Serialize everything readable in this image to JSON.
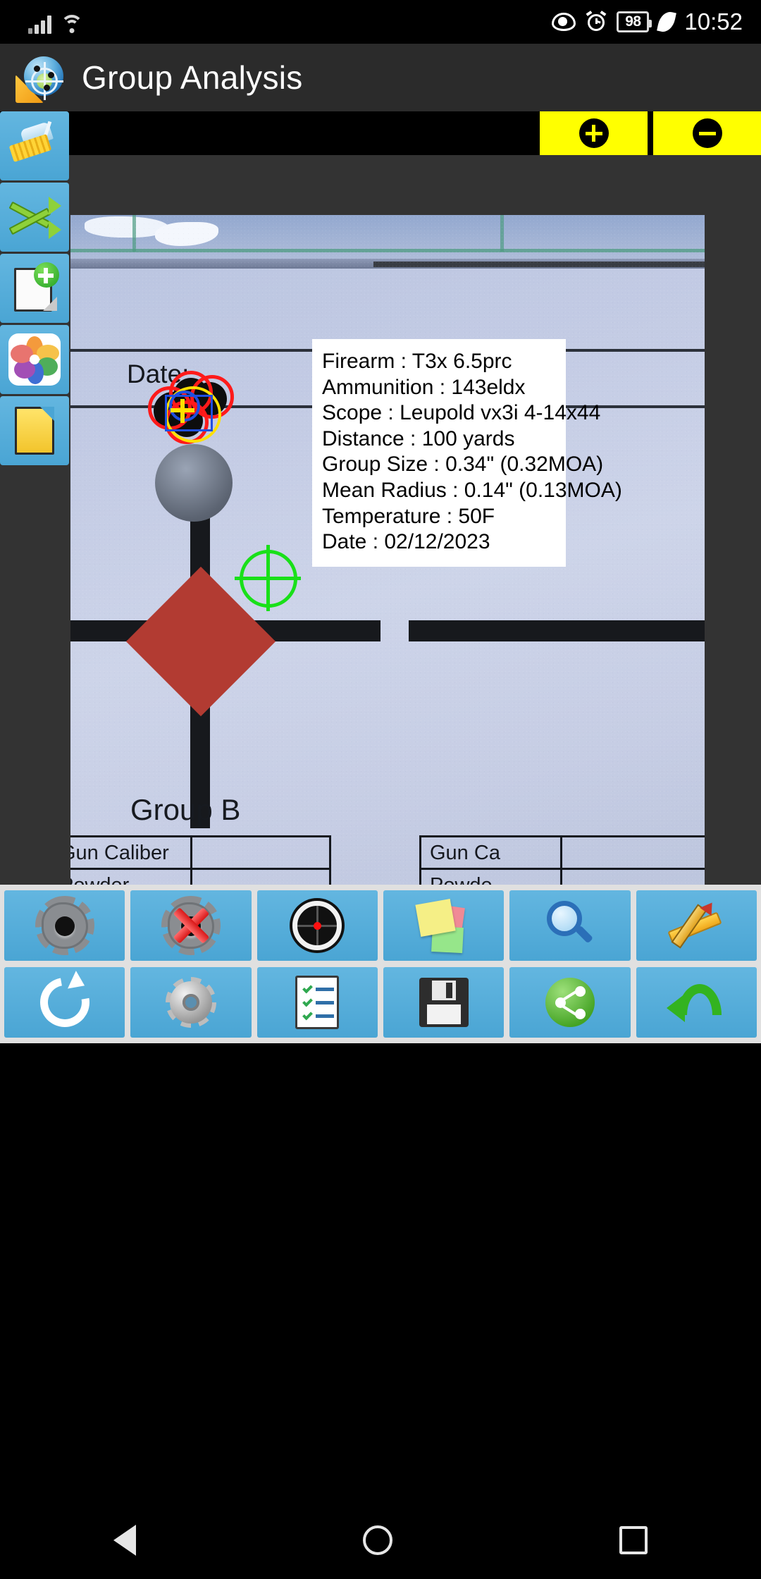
{
  "statusbar": {
    "time": "10:52",
    "battery": "98",
    "icons": [
      "signal-bars-icon",
      "wifi-icon",
      "eye-icon",
      "alarm-icon",
      "battery-icon",
      "leaf-icon"
    ]
  },
  "appbar": {
    "title": "Group Analysis",
    "logo": "group-analysis-logo-icon"
  },
  "zoom_controls": [
    {
      "name": "zoom-in-button",
      "label": "+"
    },
    {
      "name": "zoom-out-button",
      "label": "−"
    }
  ],
  "sidebar": {
    "items": [
      {
        "name": "clean-button",
        "icon": "broom-icon"
      },
      {
        "name": "shuffle-button",
        "icon": "shuffle-arrows-icon"
      },
      {
        "name": "new-group-button",
        "icon": "new-document-plus-icon"
      },
      {
        "name": "gallery-button",
        "icon": "photos-flower-icon"
      },
      {
        "name": "notes-button",
        "icon": "yellow-document-icon"
      }
    ]
  },
  "photo": {
    "date_label": "Date:",
    "group_label": "Group B",
    "tables": [
      {
        "rows": [
          "Gun Caliber",
          "Powder"
        ]
      },
      {
        "rows": [
          "Gun Ca",
          "Powde"
        ]
      }
    ]
  },
  "info_panel": {
    "lines": [
      "Firearm : T3x 6.5prc",
      "Ammunition : 143eldx",
      "Scope : Leupold vx3i 4-14x44",
      "Distance : 100 yards",
      "Group Size : 0.34\" (0.32MOA)",
      "Mean Radius : 0.14\" (0.13MOA)",
      "Temperature : 50F",
      "Date : 02/12/2023"
    ],
    "firearm": "T3x 6.5prc",
    "ammunition": "143eldx",
    "scope": "Leupold vx3i 4-14x44",
    "distance": "100 yards",
    "group_size": "0.34\" (0.32MOA)",
    "mean_radius": "0.14\" (0.13MOA)",
    "temperature": "50F",
    "date": "02/12/2023"
  },
  "toolbar": {
    "row1": [
      {
        "name": "add-shot-button",
        "icon": "bullet-hole-icon"
      },
      {
        "name": "delete-shot-button",
        "icon": "bullet-hole-delete-icon"
      },
      {
        "name": "set-target-button",
        "icon": "target-reticle-icon"
      },
      {
        "name": "notes-button",
        "icon": "sticky-notes-icon"
      },
      {
        "name": "zoom-button",
        "icon": "magnifier-icon"
      },
      {
        "name": "measure-button",
        "icon": "ruler-pencil-icon"
      }
    ],
    "row2": [
      {
        "name": "rotate-button",
        "icon": "refresh-rotate-icon"
      },
      {
        "name": "settings-button",
        "icon": "gear-icon"
      },
      {
        "name": "report-button",
        "icon": "checklist-icon"
      },
      {
        "name": "save-button",
        "icon": "floppy-disk-icon"
      },
      {
        "name": "share-button",
        "icon": "share-icon"
      },
      {
        "name": "back-button",
        "icon": "undo-arrow-icon"
      }
    ]
  },
  "navbar": {
    "items": [
      {
        "name": "nav-back-button",
        "icon": "triangle-back-icon"
      },
      {
        "name": "nav-home-button",
        "icon": "circle-home-icon"
      },
      {
        "name": "nav-recents-button",
        "icon": "square-recents-icon"
      }
    ]
  },
  "colors": {
    "accent_blue": "#4aa5d4",
    "zoom_yellow": "#ffff00",
    "appbar": "#2b2b2b",
    "toolbar_bg": "#e0e0e0",
    "reticle_green": "#19e019",
    "diamond_red": "#b23b32"
  }
}
